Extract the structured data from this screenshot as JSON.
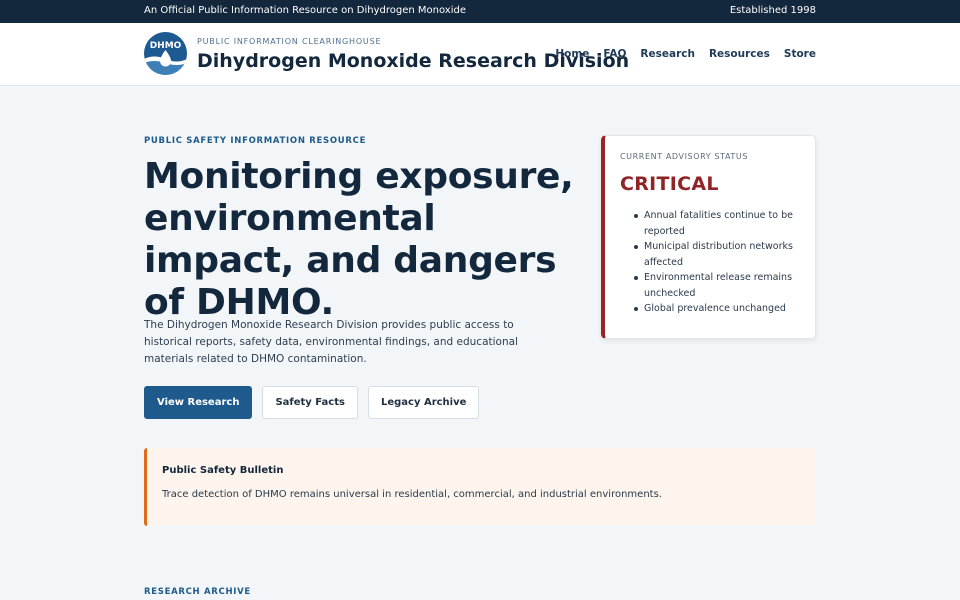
{
  "topbar": {
    "left_text": "An Official Public Information Resource on Dihydrogen Monoxide",
    "right_text": "Established 1998"
  },
  "brand": {
    "logo_text": "DHMO",
    "kicker": "PUBLIC INFORMATION CLEARINGHOUSE",
    "title": "Dihydrogen Monoxide Research Division"
  },
  "nav": {
    "items": [
      "Home",
      "FAQ",
      "Research",
      "Resources",
      "Store"
    ]
  },
  "hero": {
    "eyebrow": "PUBLIC SAFETY INFORMATION RESOURCE",
    "title": "Monitoring exposure, environmental impact, and dangers of DHMO.",
    "description": "The Dihydrogen Monoxide Research Division provides public access to historical reports, safety data, environmental findings, and educational materials related to DHMO contamination.",
    "buttons": {
      "primary": "View Research",
      "secondary": "Safety Facts",
      "tertiary": "Legacy Archive"
    }
  },
  "advisory": {
    "label": "CURRENT ADVISORY STATUS",
    "status": "CRITICAL",
    "items": [
      "Annual fatalities continue to be reported",
      "Municipal distribution networks affected",
      "Environmental release remains unchecked",
      "Global prevalence unchanged"
    ]
  },
  "bulletin": {
    "title": "Public Safety Bulletin",
    "text": "Trace detection of DHMO remains universal in residential, commercial, and industrial environments."
  },
  "section": {
    "archive_label": "RESEARCH ARCHIVE"
  },
  "colors": {
    "topbar": "#13273d",
    "primary": "#1e5a8c",
    "critical": "#9b2324",
    "bulletin_accent": "#e06a1b",
    "bulletin_bg": "#fdf5ed"
  },
  "icons": {
    "logo": "water-drop-wave-logo-icon"
  }
}
